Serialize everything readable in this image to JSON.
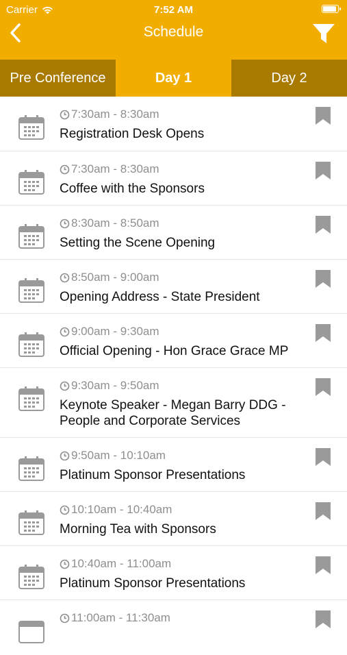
{
  "status": {
    "carrier": "Carrier",
    "time": "7:52 AM"
  },
  "nav": {
    "title": "Schedule"
  },
  "tabs": [
    {
      "label": "Pre Conference",
      "active": false
    },
    {
      "label": "Day 1",
      "active": true
    },
    {
      "label": "Day 2",
      "active": false
    }
  ],
  "sessions": [
    {
      "time": "7:30am - 8:30am",
      "title": "Registration Desk Opens"
    },
    {
      "time": "7:30am - 8:30am",
      "title": "Coffee with the Sponsors"
    },
    {
      "time": "8:30am - 8:50am",
      "title": "Setting the Scene Opening"
    },
    {
      "time": "8:50am - 9:00am",
      "title": "Opening Address - State President"
    },
    {
      "time": "9:00am - 9:30am",
      "title": "Official Opening - Hon Grace Grace MP"
    },
    {
      "time": "9:30am - 9:50am",
      "title": "Keynote Speaker - Megan Barry DDG - People and Corporate Services"
    },
    {
      "time": "9:50am - 10:10am",
      "title": "Platinum Sponsor Presentations"
    },
    {
      "time": "10:10am - 10:40am",
      "title": "Morning Tea with Sponsors"
    },
    {
      "time": "10:40am - 11:00am",
      "title": "Platinum Sponsor Presentations"
    },
    {
      "time": "11:00am - 11:30am",
      "title": ""
    }
  ],
  "colors": {
    "accent": "#F1AE00",
    "tab_inactive": "#A97A00",
    "icon_gray": "#9a9a9a"
  },
  "icons": {
    "back": "chevron-left-icon",
    "filter": "filter-icon",
    "event": "calendar-icon",
    "bookmark": "bookmark-icon",
    "time": "clock-icon"
  }
}
